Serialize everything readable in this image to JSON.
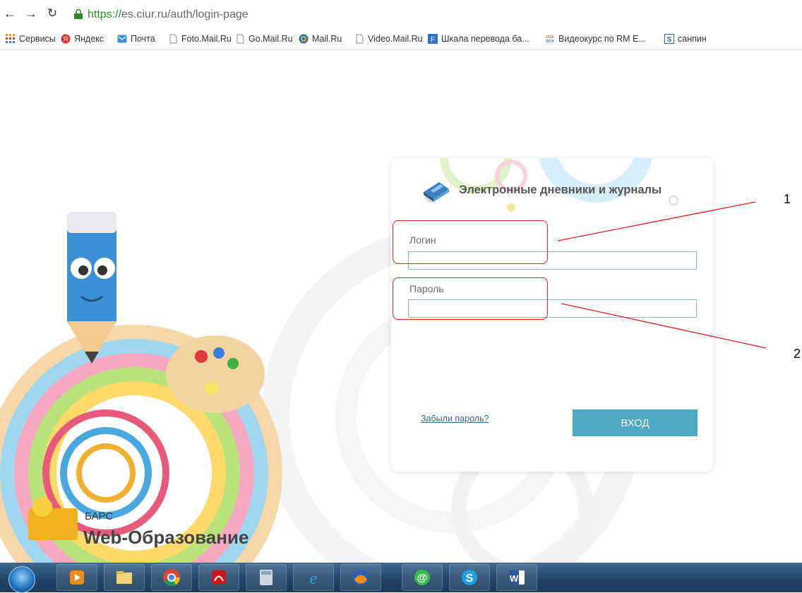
{
  "browser": {
    "url_protocol": "https://",
    "url_rest": "es.ciur.ru/auth/login-page",
    "bookmarks": [
      {
        "label": "Сервисы",
        "icon": "apps-grid-icon"
      },
      {
        "label": "Яндекс",
        "icon": "yandex-icon"
      },
      {
        "label": "Почта",
        "icon": "mail-icon"
      },
      {
        "label": "Foto.Mail.Ru",
        "icon": "page-icon"
      },
      {
        "label": "Go.Mail.Ru",
        "icon": "page-icon"
      },
      {
        "label": "Mail.Ru",
        "icon": "mailru-icon"
      },
      {
        "label": "Video.Mail.Ru",
        "icon": "page-icon"
      },
      {
        "label": "Шкала перевода ба...",
        "icon": "scale-icon"
      },
      {
        "label": "Видеокурс по RM E...",
        "icon": "jade-icon"
      },
      {
        "label": "санпин",
        "icon": "s-icon"
      }
    ]
  },
  "login": {
    "title": "Электронные дневники и журналы",
    "login_label": "Логин",
    "login_value": "",
    "password_label": "Пароль",
    "password_value": "",
    "forgot_label": "Забыли пароль?",
    "submit_label": "ВХОД"
  },
  "branding": {
    "company": "БАРС",
    "product": "Web-Образование"
  },
  "annotations": {
    "label_1": "1",
    "label_2": "2",
    "color": "#e02020"
  },
  "taskbar": {
    "apps": [
      "media-player-icon",
      "file-explorer-icon",
      "chrome-icon",
      "acrobat-icon",
      "calculator-icon",
      "ie-icon",
      "firefox-icon",
      "mail-agent-icon",
      "skype-icon",
      "word-icon"
    ]
  }
}
